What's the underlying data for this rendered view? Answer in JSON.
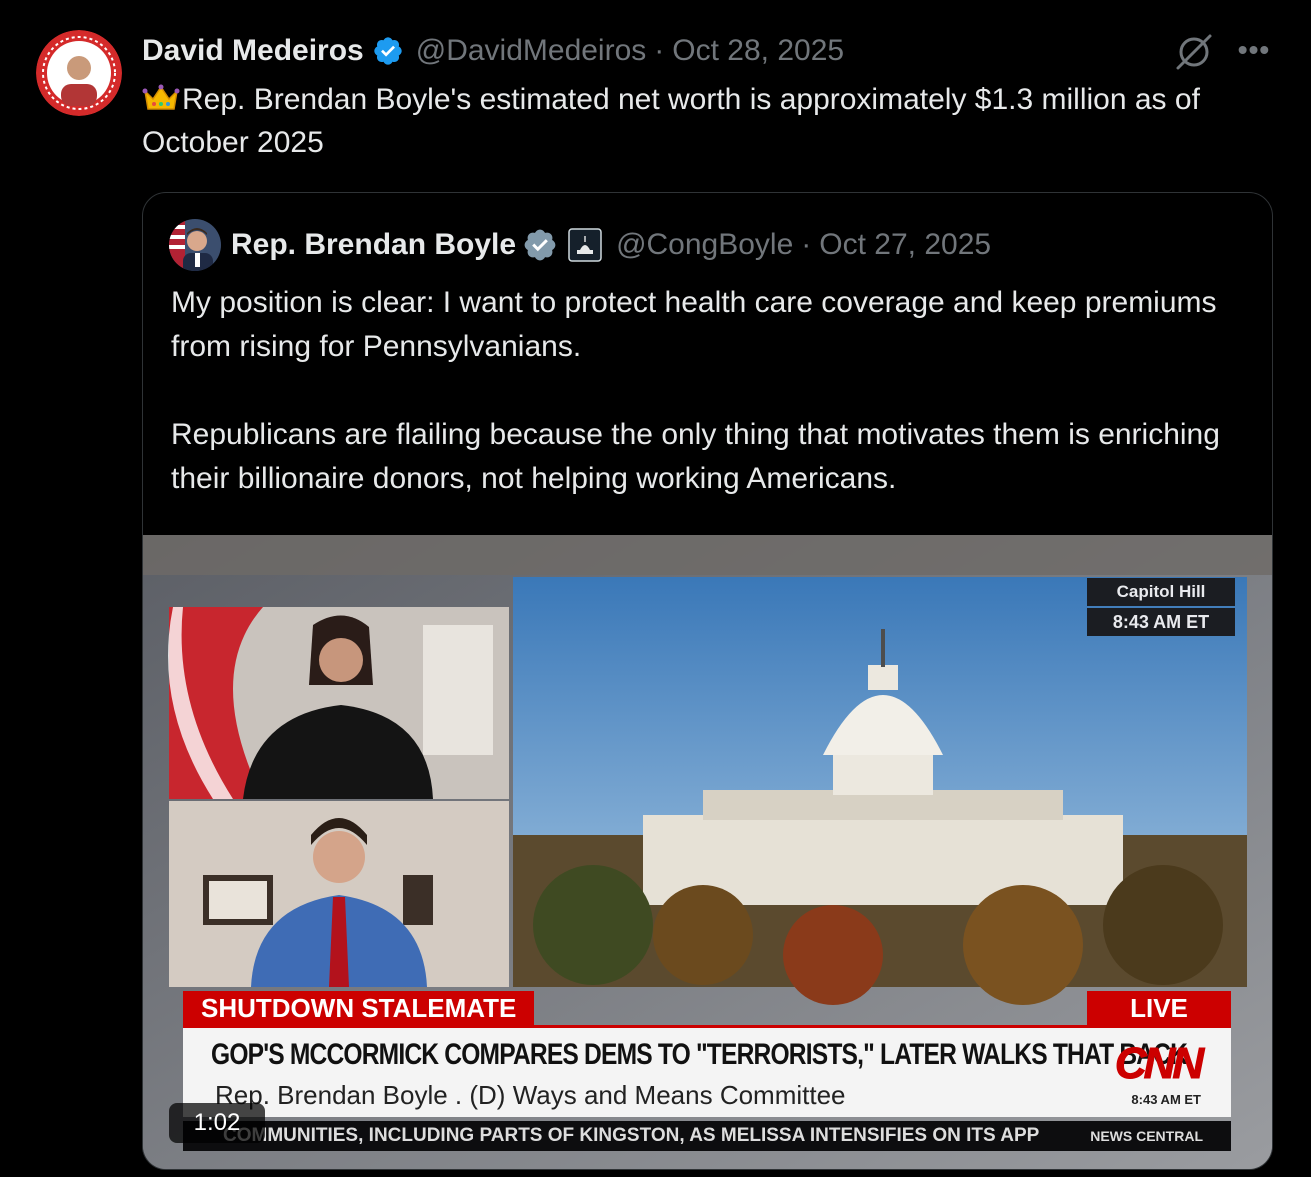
{
  "tweet": {
    "author_name": "David Medeiros",
    "author_handle": "@DavidMedeiros",
    "separator": "·",
    "date": "Oct 28, 2025",
    "text": "Rep. Brendan Boyle's estimated net worth is approximately $1.3 million as of October 2025",
    "leading_emoji": "crown-emoji",
    "icons": {
      "verified": "verified-badge-icon",
      "grok": "grok-icon",
      "more": "more-options-icon"
    },
    "more_label": "•••",
    "verified_color": "#1d9bf0"
  },
  "quoted_tweet": {
    "author_name": "Rep. Brendan Boyle",
    "author_handle": "@CongBoyle",
    "separator": "·",
    "date": "Oct 27, 2025",
    "paragraphs": [
      "My position is clear: I want to protect health care coverage and keep premiums from rising for Pennsylvanians.",
      "Republicans are flailing because the only thing that motivates them is enriching their billionaire donors, not helping working Americans."
    ],
    "verified_color": "#829aab",
    "affiliation_icon": "us-capitol-icon"
  },
  "video": {
    "duration": "1:02",
    "location_tag": "Capitol Hill",
    "time_tag": "8:43 AM ET",
    "banner_label": "SHUTDOWN STALEMATE",
    "live_label": "LIVE",
    "headline": "GOP'S MCCORMICK COMPARES DEMS TO \"TERRORISTS,\" LATER WALKS THAT BACK",
    "subline": "Rep. Brendan Boyle . (D) Ways and Means Committee",
    "network_logo": "CNN",
    "logo_time": "8:43 AM ET",
    "ticker": "COMMUNITIES, INCLUDING PARTS OF KINGSTON, AS MELISSA INTENSIFIES ON ITS APP",
    "ticker_brand": "NEWS CENTRAL",
    "accent_color": "#cc0000"
  }
}
